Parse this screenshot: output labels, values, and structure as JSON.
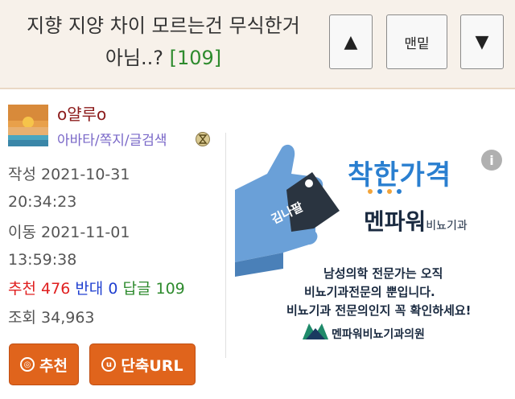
{
  "header": {
    "title_line1": "지향 지양 차이 모르는건 무식한거",
    "title_line2": "아님..?",
    "comment_count": "[109]",
    "up_label": "▲",
    "bottom_label": "맨밑",
    "down_label": "▼"
  },
  "author": {
    "name": "o얄루o",
    "links": "아바타/쪽지/글검색"
  },
  "meta": {
    "written_label": "작성",
    "written_date": "2021-10-31",
    "written_time": "20:34:23",
    "moved_label": "이동",
    "moved_date": "2021-11-01",
    "moved_time": "13:59:38",
    "recommend_label": "추천",
    "recommend_value": "476",
    "oppose_label": "반대",
    "oppose_value": "0",
    "reply_label": "답글",
    "reply_value": "109",
    "views_label": "조회",
    "views_value": "34,963"
  },
  "actions": {
    "recommend_label": "추천",
    "shorturl_label": "단축URL"
  },
  "ad": {
    "headline": "착한가격",
    "brand": "멘파워",
    "brand_suffix": "비뇨기과",
    "tag_text": "김나팔",
    "line1": "남성의학 전문가는 오직",
    "line2": "비뇨기과전문의 뿐입니다.",
    "line3": "비뇨기과 전문의인지 꼭 확인하세요!",
    "footer": "멘파워비뇨기과의원"
  },
  "colors": {
    "accent_button": "#e0641c",
    "author_name": "#8b1a1a",
    "links": "#7a68c8",
    "recommend": "#e02020",
    "oppose": "#1f3fd0",
    "reply": "#2e8b2e",
    "ad_blue": "#2a7fd0"
  }
}
